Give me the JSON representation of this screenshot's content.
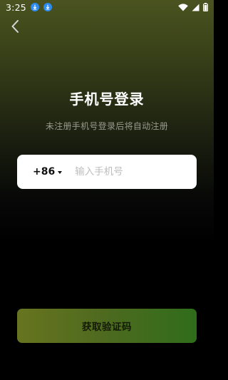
{
  "status_bar": {
    "time": "3:25",
    "notification_icons": [
      "download-notification-icon",
      "download-notification-icon"
    ],
    "system_icons": [
      "wifi-icon",
      "cellular-signal-icon",
      "battery-icon"
    ]
  },
  "header": {
    "back_icon": "chevron-left-icon"
  },
  "main": {
    "title": "手机号登录",
    "subtitle": "未注册手机号登录后将自动注册",
    "phone": {
      "country_code": "+86",
      "placeholder": "输入手机号",
      "value": ""
    },
    "get_code_button": "获取验证码"
  },
  "colors": {
    "accent_green": "#2f6d1b",
    "accent_olive": "#67741f"
  }
}
